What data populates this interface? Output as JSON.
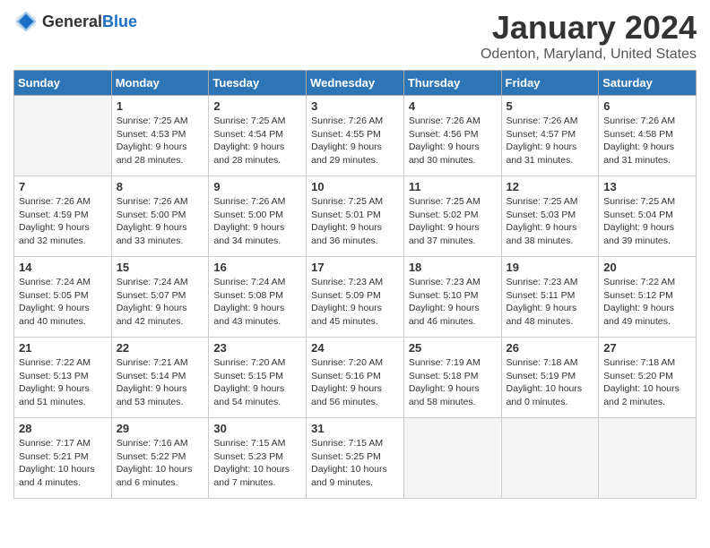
{
  "logo": {
    "text_general": "General",
    "text_blue": "Blue"
  },
  "title": "January 2024",
  "location": "Odenton, Maryland, United States",
  "days_of_week": [
    "Sunday",
    "Monday",
    "Tuesday",
    "Wednesday",
    "Thursday",
    "Friday",
    "Saturday"
  ],
  "weeks": [
    [
      {
        "day": "",
        "sunrise": "",
        "sunset": "",
        "daylight": "",
        "empty": true
      },
      {
        "day": "1",
        "sunrise": "Sunrise: 7:25 AM",
        "sunset": "Sunset: 4:53 PM",
        "daylight": "Daylight: 9 hours and 28 minutes."
      },
      {
        "day": "2",
        "sunrise": "Sunrise: 7:25 AM",
        "sunset": "Sunset: 4:54 PM",
        "daylight": "Daylight: 9 hours and 28 minutes."
      },
      {
        "day": "3",
        "sunrise": "Sunrise: 7:26 AM",
        "sunset": "Sunset: 4:55 PM",
        "daylight": "Daylight: 9 hours and 29 minutes."
      },
      {
        "day": "4",
        "sunrise": "Sunrise: 7:26 AM",
        "sunset": "Sunset: 4:56 PM",
        "daylight": "Daylight: 9 hours and 30 minutes."
      },
      {
        "day": "5",
        "sunrise": "Sunrise: 7:26 AM",
        "sunset": "Sunset: 4:57 PM",
        "daylight": "Daylight: 9 hours and 31 minutes."
      },
      {
        "day": "6",
        "sunrise": "Sunrise: 7:26 AM",
        "sunset": "Sunset: 4:58 PM",
        "daylight": "Daylight: 9 hours and 31 minutes."
      }
    ],
    [
      {
        "day": "7",
        "sunrise": "Sunrise: 7:26 AM",
        "sunset": "Sunset: 4:59 PM",
        "daylight": "Daylight: 9 hours and 32 minutes."
      },
      {
        "day": "8",
        "sunrise": "Sunrise: 7:26 AM",
        "sunset": "Sunset: 5:00 PM",
        "daylight": "Daylight: 9 hours and 33 minutes."
      },
      {
        "day": "9",
        "sunrise": "Sunrise: 7:26 AM",
        "sunset": "Sunset: 5:00 PM",
        "daylight": "Daylight: 9 hours and 34 minutes."
      },
      {
        "day": "10",
        "sunrise": "Sunrise: 7:25 AM",
        "sunset": "Sunset: 5:01 PM",
        "daylight": "Daylight: 9 hours and 36 minutes."
      },
      {
        "day": "11",
        "sunrise": "Sunrise: 7:25 AM",
        "sunset": "Sunset: 5:02 PM",
        "daylight": "Daylight: 9 hours and 37 minutes."
      },
      {
        "day": "12",
        "sunrise": "Sunrise: 7:25 AM",
        "sunset": "Sunset: 5:03 PM",
        "daylight": "Daylight: 9 hours and 38 minutes."
      },
      {
        "day": "13",
        "sunrise": "Sunrise: 7:25 AM",
        "sunset": "Sunset: 5:04 PM",
        "daylight": "Daylight: 9 hours and 39 minutes."
      }
    ],
    [
      {
        "day": "14",
        "sunrise": "Sunrise: 7:24 AM",
        "sunset": "Sunset: 5:05 PM",
        "daylight": "Daylight: 9 hours and 40 minutes."
      },
      {
        "day": "15",
        "sunrise": "Sunrise: 7:24 AM",
        "sunset": "Sunset: 5:07 PM",
        "daylight": "Daylight: 9 hours and 42 minutes."
      },
      {
        "day": "16",
        "sunrise": "Sunrise: 7:24 AM",
        "sunset": "Sunset: 5:08 PM",
        "daylight": "Daylight: 9 hours and 43 minutes."
      },
      {
        "day": "17",
        "sunrise": "Sunrise: 7:23 AM",
        "sunset": "Sunset: 5:09 PM",
        "daylight": "Daylight: 9 hours and 45 minutes."
      },
      {
        "day": "18",
        "sunrise": "Sunrise: 7:23 AM",
        "sunset": "Sunset: 5:10 PM",
        "daylight": "Daylight: 9 hours and 46 minutes."
      },
      {
        "day": "19",
        "sunrise": "Sunrise: 7:23 AM",
        "sunset": "Sunset: 5:11 PM",
        "daylight": "Daylight: 9 hours and 48 minutes."
      },
      {
        "day": "20",
        "sunrise": "Sunrise: 7:22 AM",
        "sunset": "Sunset: 5:12 PM",
        "daylight": "Daylight: 9 hours and 49 minutes."
      }
    ],
    [
      {
        "day": "21",
        "sunrise": "Sunrise: 7:22 AM",
        "sunset": "Sunset: 5:13 PM",
        "daylight": "Daylight: 9 hours and 51 minutes."
      },
      {
        "day": "22",
        "sunrise": "Sunrise: 7:21 AM",
        "sunset": "Sunset: 5:14 PM",
        "daylight": "Daylight: 9 hours and 53 minutes."
      },
      {
        "day": "23",
        "sunrise": "Sunrise: 7:20 AM",
        "sunset": "Sunset: 5:15 PM",
        "daylight": "Daylight: 9 hours and 54 minutes."
      },
      {
        "day": "24",
        "sunrise": "Sunrise: 7:20 AM",
        "sunset": "Sunset: 5:16 PM",
        "daylight": "Daylight: 9 hours and 56 minutes."
      },
      {
        "day": "25",
        "sunrise": "Sunrise: 7:19 AM",
        "sunset": "Sunset: 5:18 PM",
        "daylight": "Daylight: 9 hours and 58 minutes."
      },
      {
        "day": "26",
        "sunrise": "Sunrise: 7:18 AM",
        "sunset": "Sunset: 5:19 PM",
        "daylight": "Daylight: 10 hours and 0 minutes."
      },
      {
        "day": "27",
        "sunrise": "Sunrise: 7:18 AM",
        "sunset": "Sunset: 5:20 PM",
        "daylight": "Daylight: 10 hours and 2 minutes."
      }
    ],
    [
      {
        "day": "28",
        "sunrise": "Sunrise: 7:17 AM",
        "sunset": "Sunset: 5:21 PM",
        "daylight": "Daylight: 10 hours and 4 minutes."
      },
      {
        "day": "29",
        "sunrise": "Sunrise: 7:16 AM",
        "sunset": "Sunset: 5:22 PM",
        "daylight": "Daylight: 10 hours and 6 minutes."
      },
      {
        "day": "30",
        "sunrise": "Sunrise: 7:15 AM",
        "sunset": "Sunset: 5:23 PM",
        "daylight": "Daylight: 10 hours and 7 minutes."
      },
      {
        "day": "31",
        "sunrise": "Sunrise: 7:15 AM",
        "sunset": "Sunset: 5:25 PM",
        "daylight": "Daylight: 10 hours and 9 minutes."
      },
      {
        "day": "",
        "sunrise": "",
        "sunset": "",
        "daylight": "",
        "empty": true
      },
      {
        "day": "",
        "sunrise": "",
        "sunset": "",
        "daylight": "",
        "empty": true
      },
      {
        "day": "",
        "sunrise": "",
        "sunset": "",
        "daylight": "",
        "empty": true
      }
    ]
  ]
}
